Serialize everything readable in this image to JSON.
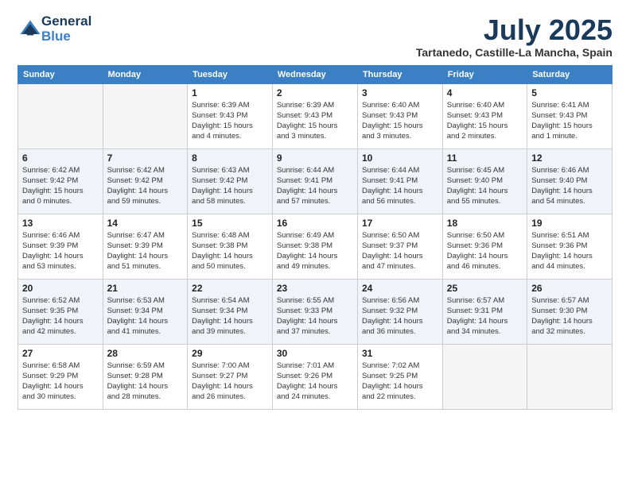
{
  "logo": {
    "line1": "General",
    "line2": "Blue"
  },
  "title": {
    "month": "July 2025",
    "location": "Tartanedo, Castille-La Mancha, Spain"
  },
  "weekdays": [
    "Sunday",
    "Monday",
    "Tuesday",
    "Wednesday",
    "Thursday",
    "Friday",
    "Saturday"
  ],
  "weeks": [
    [
      {
        "day": "",
        "info": ""
      },
      {
        "day": "",
        "info": ""
      },
      {
        "day": "1",
        "info": "Sunrise: 6:39 AM\nSunset: 9:43 PM\nDaylight: 15 hours\nand 4 minutes."
      },
      {
        "day": "2",
        "info": "Sunrise: 6:39 AM\nSunset: 9:43 PM\nDaylight: 15 hours\nand 3 minutes."
      },
      {
        "day": "3",
        "info": "Sunrise: 6:40 AM\nSunset: 9:43 PM\nDaylight: 15 hours\nand 3 minutes."
      },
      {
        "day": "4",
        "info": "Sunrise: 6:40 AM\nSunset: 9:43 PM\nDaylight: 15 hours\nand 2 minutes."
      },
      {
        "day": "5",
        "info": "Sunrise: 6:41 AM\nSunset: 9:43 PM\nDaylight: 15 hours\nand 1 minute."
      }
    ],
    [
      {
        "day": "6",
        "info": "Sunrise: 6:42 AM\nSunset: 9:42 PM\nDaylight: 15 hours\nand 0 minutes."
      },
      {
        "day": "7",
        "info": "Sunrise: 6:42 AM\nSunset: 9:42 PM\nDaylight: 14 hours\nand 59 minutes."
      },
      {
        "day": "8",
        "info": "Sunrise: 6:43 AM\nSunset: 9:42 PM\nDaylight: 14 hours\nand 58 minutes."
      },
      {
        "day": "9",
        "info": "Sunrise: 6:44 AM\nSunset: 9:41 PM\nDaylight: 14 hours\nand 57 minutes."
      },
      {
        "day": "10",
        "info": "Sunrise: 6:44 AM\nSunset: 9:41 PM\nDaylight: 14 hours\nand 56 minutes."
      },
      {
        "day": "11",
        "info": "Sunrise: 6:45 AM\nSunset: 9:40 PM\nDaylight: 14 hours\nand 55 minutes."
      },
      {
        "day": "12",
        "info": "Sunrise: 6:46 AM\nSunset: 9:40 PM\nDaylight: 14 hours\nand 54 minutes."
      }
    ],
    [
      {
        "day": "13",
        "info": "Sunrise: 6:46 AM\nSunset: 9:39 PM\nDaylight: 14 hours\nand 53 minutes."
      },
      {
        "day": "14",
        "info": "Sunrise: 6:47 AM\nSunset: 9:39 PM\nDaylight: 14 hours\nand 51 minutes."
      },
      {
        "day": "15",
        "info": "Sunrise: 6:48 AM\nSunset: 9:38 PM\nDaylight: 14 hours\nand 50 minutes."
      },
      {
        "day": "16",
        "info": "Sunrise: 6:49 AM\nSunset: 9:38 PM\nDaylight: 14 hours\nand 49 minutes."
      },
      {
        "day": "17",
        "info": "Sunrise: 6:50 AM\nSunset: 9:37 PM\nDaylight: 14 hours\nand 47 minutes."
      },
      {
        "day": "18",
        "info": "Sunrise: 6:50 AM\nSunset: 9:36 PM\nDaylight: 14 hours\nand 46 minutes."
      },
      {
        "day": "19",
        "info": "Sunrise: 6:51 AM\nSunset: 9:36 PM\nDaylight: 14 hours\nand 44 minutes."
      }
    ],
    [
      {
        "day": "20",
        "info": "Sunrise: 6:52 AM\nSunset: 9:35 PM\nDaylight: 14 hours\nand 42 minutes."
      },
      {
        "day": "21",
        "info": "Sunrise: 6:53 AM\nSunset: 9:34 PM\nDaylight: 14 hours\nand 41 minutes."
      },
      {
        "day": "22",
        "info": "Sunrise: 6:54 AM\nSunset: 9:34 PM\nDaylight: 14 hours\nand 39 minutes."
      },
      {
        "day": "23",
        "info": "Sunrise: 6:55 AM\nSunset: 9:33 PM\nDaylight: 14 hours\nand 37 minutes."
      },
      {
        "day": "24",
        "info": "Sunrise: 6:56 AM\nSunset: 9:32 PM\nDaylight: 14 hours\nand 36 minutes."
      },
      {
        "day": "25",
        "info": "Sunrise: 6:57 AM\nSunset: 9:31 PM\nDaylight: 14 hours\nand 34 minutes."
      },
      {
        "day": "26",
        "info": "Sunrise: 6:57 AM\nSunset: 9:30 PM\nDaylight: 14 hours\nand 32 minutes."
      }
    ],
    [
      {
        "day": "27",
        "info": "Sunrise: 6:58 AM\nSunset: 9:29 PM\nDaylight: 14 hours\nand 30 minutes."
      },
      {
        "day": "28",
        "info": "Sunrise: 6:59 AM\nSunset: 9:28 PM\nDaylight: 14 hours\nand 28 minutes."
      },
      {
        "day": "29",
        "info": "Sunrise: 7:00 AM\nSunset: 9:27 PM\nDaylight: 14 hours\nand 26 minutes."
      },
      {
        "day": "30",
        "info": "Sunrise: 7:01 AM\nSunset: 9:26 PM\nDaylight: 14 hours\nand 24 minutes."
      },
      {
        "day": "31",
        "info": "Sunrise: 7:02 AM\nSunset: 9:25 PM\nDaylight: 14 hours\nand 22 minutes."
      },
      {
        "day": "",
        "info": ""
      },
      {
        "day": "",
        "info": ""
      }
    ]
  ]
}
